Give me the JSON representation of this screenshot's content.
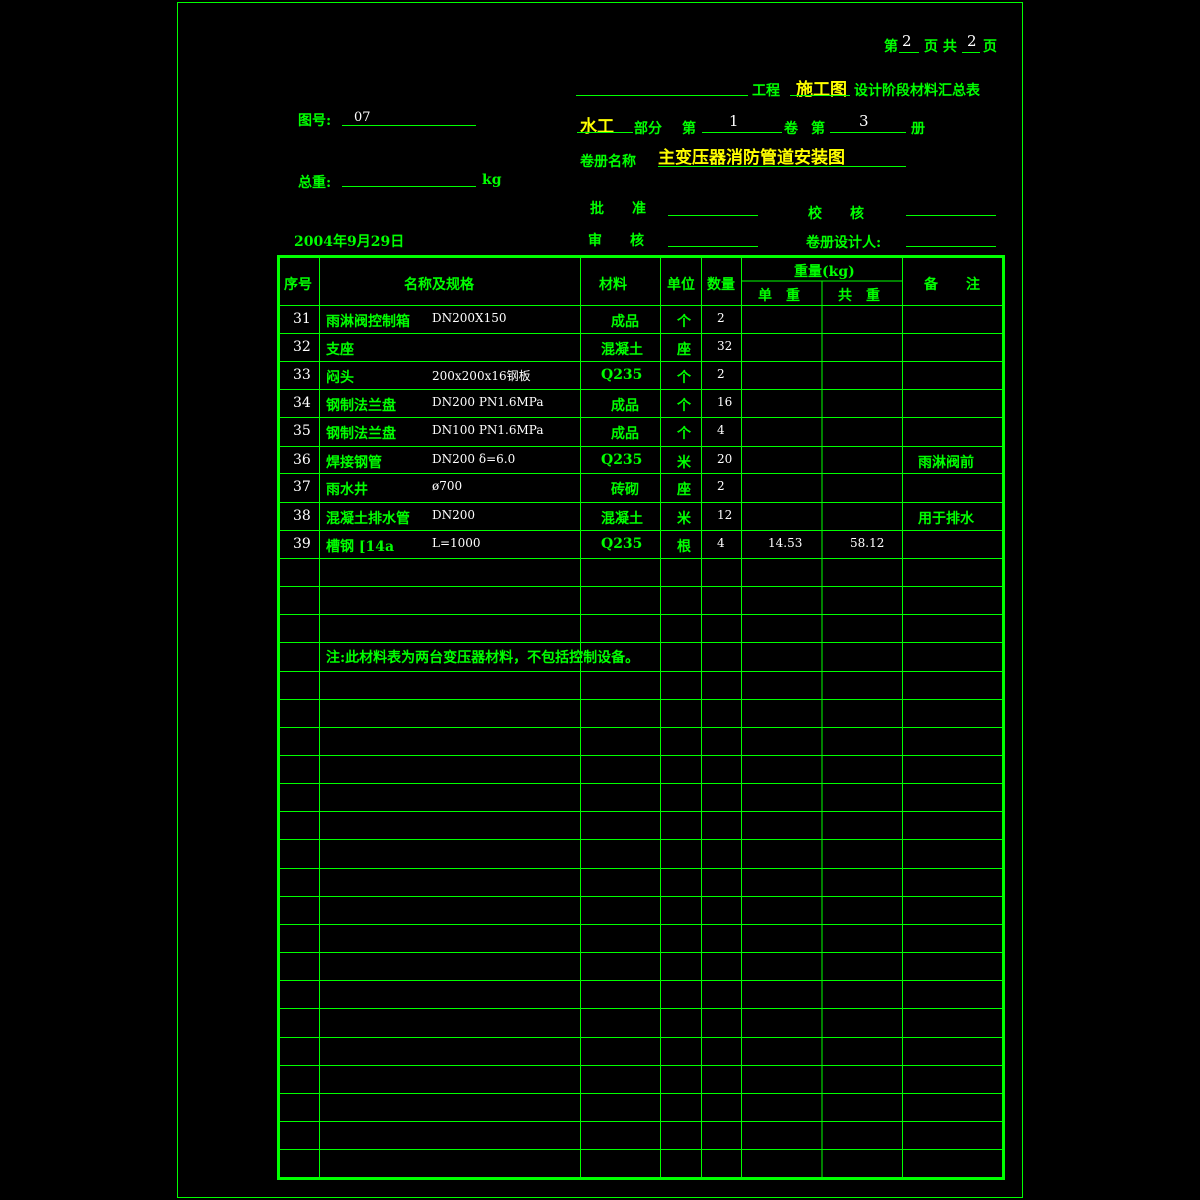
{
  "page_info": {
    "page_prefix": "第",
    "page_no": "2",
    "page_mid": "页 共",
    "page_total": "2",
    "page_suffix": "页"
  },
  "project": {
    "project_label": "工程",
    "stage": "施工图",
    "summary_title": "设计阶段材料汇总表"
  },
  "drawing": {
    "number_label": "图号:",
    "number": "07",
    "total_weight_label": "总重:",
    "weight_unit": "kg",
    "date": "2004年9月29日"
  },
  "section": {
    "discipline": "水工",
    "part_label": "部分",
    "nth": "第",
    "volume_no": "1",
    "volume_label": "卷",
    "nth2": "第",
    "book_no": "3",
    "book_label": "册"
  },
  "volume_name": {
    "label": "卷册名称",
    "value": "主变压器消防管道安装图"
  },
  "signoff": {
    "approve": "批　　准",
    "check": "校　　核",
    "review": "审　　核",
    "designer": "卷册设计人:"
  },
  "table": {
    "headers": {
      "seq": "序号",
      "name": "名称及规格",
      "material": "材料",
      "unit": "单位",
      "qty": "数量",
      "weight": "重量(kg)",
      "unit_weight": "单　重",
      "total_weight": "共　重",
      "remark": "备　　注"
    },
    "rows": [
      {
        "seq": "31",
        "name": "雨淋阀控制箱",
        "spec": "DN200X150",
        "material": "成品",
        "unit": "个",
        "qty": "2",
        "unit_weight": "",
        "total_weight": "",
        "remark": ""
      },
      {
        "seq": "32",
        "name": "支座",
        "spec": "",
        "material": "混凝土",
        "unit": "座",
        "qty": "32",
        "unit_weight": "",
        "total_weight": "",
        "remark": ""
      },
      {
        "seq": "33",
        "name": "闷头",
        "spec": "200x200x16钢板",
        "material": "Q235",
        "unit": "个",
        "qty": "2",
        "unit_weight": "",
        "total_weight": "",
        "remark": ""
      },
      {
        "seq": "34",
        "name": "钢制法兰盘",
        "spec": "DN200  PN1.6MPa",
        "material": "成品",
        "unit": "个",
        "qty": "16",
        "unit_weight": "",
        "total_weight": "",
        "remark": ""
      },
      {
        "seq": "35",
        "name": "钢制法兰盘",
        "spec": "DN100  PN1.6MPa",
        "material": "成品",
        "unit": "个",
        "qty": "4",
        "unit_weight": "",
        "total_weight": "",
        "remark": ""
      },
      {
        "seq": "36",
        "name": "焊接钢管",
        "spec": "DN200      δ=6.0",
        "material": "Q235",
        "unit": "米",
        "qty": "20",
        "unit_weight": "",
        "total_weight": "",
        "remark": "雨淋阀前"
      },
      {
        "seq": "37",
        "name": "雨水井",
        "spec": "ø700",
        "material": "砖砌",
        "unit": "座",
        "qty": "2",
        "unit_weight": "",
        "total_weight": "",
        "remark": ""
      },
      {
        "seq": "38",
        "name": "混凝土排水管",
        "spec": "DN200",
        "material": "混凝土",
        "unit": "米",
        "qty": "12",
        "unit_weight": "",
        "total_weight": "",
        "remark": "用于排水"
      },
      {
        "seq": "39",
        "name": "槽钢  [14a",
        "spec": "L=1000",
        "material": "Q235",
        "unit": "根",
        "qty": "4",
        "unit_weight": "14.53",
        "total_weight": "58.12",
        "remark": ""
      }
    ],
    "note": "注:此材料表为两台变压器材料，不包括控制设备。"
  }
}
